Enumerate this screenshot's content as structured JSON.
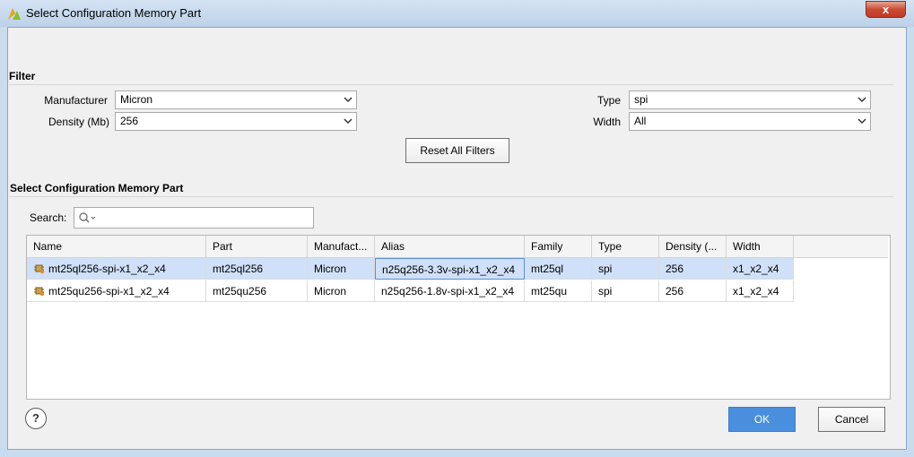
{
  "window": {
    "title": "Select Configuration Memory Part",
    "close_glyph": "x"
  },
  "filter": {
    "section_title": "Filter",
    "manufacturer": {
      "label": "Manufacturer",
      "value": "Micron"
    },
    "density": {
      "label": "Density (Mb)",
      "value": "256"
    },
    "type": {
      "label": "Type",
      "value": "spi"
    },
    "width": {
      "label": "Width",
      "value": "All"
    },
    "reset_button": "Reset All Filters"
  },
  "parts": {
    "section_title": "Select Configuration Memory Part",
    "search_label": "Search:",
    "search_value": "",
    "columns": [
      "Name",
      "Part",
      "Manufact...",
      "Alias",
      "Family",
      "Type",
      "Density (...",
      "Width"
    ],
    "rows": [
      {
        "selected": true,
        "icon": "chip-icon",
        "cells": [
          "mt25ql256-spi-x1_x2_x4",
          "mt25ql256",
          "Micron",
          "n25q256-3.3v-spi-x1_x2_x4",
          "mt25ql",
          "spi",
          "256",
          "x1_x2_x4"
        ]
      },
      {
        "selected": false,
        "icon": "chip-icon",
        "cells": [
          "mt25qu256-spi-x1_x2_x4",
          "mt25qu256",
          "Micron",
          "n25q256-1.8v-spi-x1_x2_x4",
          "mt25qu",
          "spi",
          "256",
          "x1_x2_x4"
        ]
      }
    ]
  },
  "footer": {
    "help": "?",
    "ok": "OK",
    "cancel": "Cancel"
  },
  "colors": {
    "accent": "#4a8fde",
    "selection": "#cfe0f8",
    "title_bar": "#c9dcef"
  }
}
